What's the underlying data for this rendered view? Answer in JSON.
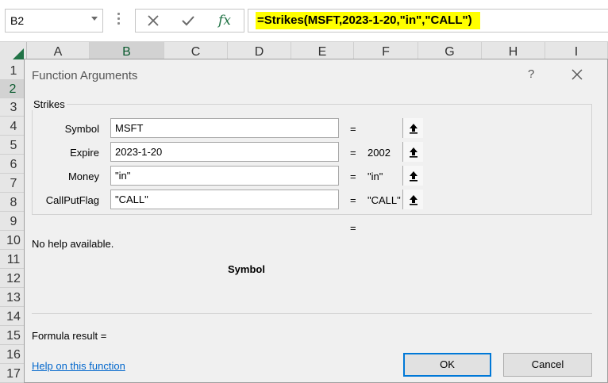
{
  "name_box": {
    "value": "B2"
  },
  "formula_bar": {
    "formula": "=Strikes(MSFT,2023-1-20,\"in\",\"CALL\")",
    "icons": [
      "cancel-icon",
      "enter-checkmark-icon",
      "insert-function-icon"
    ],
    "fx_label": "fx",
    "highlight_color": "#ffff00"
  },
  "columns": [
    "A",
    "B",
    "C",
    "D",
    "E",
    "F",
    "G",
    "H",
    "I"
  ],
  "selected_column": "B",
  "rows": [
    "1",
    "2",
    "3",
    "4",
    "5",
    "6",
    "7",
    "8",
    "9",
    "10",
    "11",
    "12",
    "13",
    "14",
    "15",
    "16",
    "17"
  ],
  "selected_row": "2",
  "dialog": {
    "title": "Function Arguments",
    "help_glyph": "?",
    "function_name": "Strikes",
    "arguments": [
      {
        "label": "Symbol",
        "value": "MSFT",
        "equals": "=",
        "result": ""
      },
      {
        "label": "Expire",
        "value": "2023-1-20",
        "equals": "=",
        "result": "2002"
      },
      {
        "label": "Money",
        "value": "\"in\"",
        "equals": "=",
        "result": "\"in\""
      },
      {
        "label": "CallPutFlag",
        "value": "\"CALL\"",
        "equals": "=",
        "result": "\"CALL\""
      }
    ],
    "overall_equals": "=",
    "help_text": "No help available.",
    "current_argument": "Symbol",
    "formula_result_label": "Formula result =",
    "help_link": "Help on this function",
    "ok_label": "OK",
    "cancel_label": "Cancel",
    "accent_color": "#0078d7"
  },
  "colors": {
    "excel_green": "#217346"
  }
}
